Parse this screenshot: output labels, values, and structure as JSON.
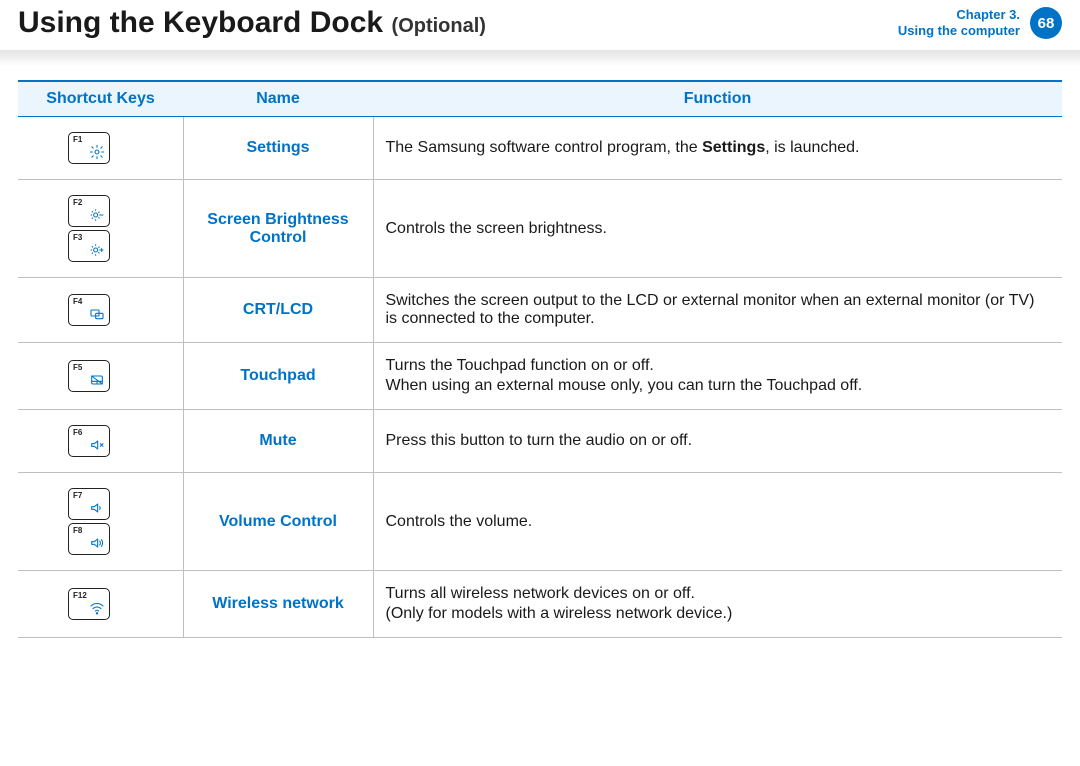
{
  "header": {
    "title_main": "Using the Keyboard Dock",
    "title_sub": "(Optional)",
    "chapter_line1": "Chapter 3.",
    "chapter_line2": "Using the computer",
    "page_number": "68"
  },
  "table": {
    "headers": {
      "keys": "Shortcut Keys",
      "name": "Name",
      "function": "Function"
    },
    "rows": [
      {
        "keys": [
          "F1"
        ],
        "icon": "settings",
        "name": "Settings",
        "function_prefix": "The Samsung software control program, the ",
        "function_bold": "Settings",
        "function_suffix": ", is launched."
      },
      {
        "keys": [
          "F2",
          "F3"
        ],
        "icon": "brightness",
        "name": "Screen Brightness Control",
        "function_line1": "Controls the screen brightness."
      },
      {
        "keys": [
          "F4"
        ],
        "icon": "crtlcd",
        "name": "CRT/LCD",
        "function_line1": "Switches the screen output to the LCD or external monitor when an external monitor (or TV) is connected to the computer."
      },
      {
        "keys": [
          "F5"
        ],
        "icon": "touchpad",
        "name": "Touchpad",
        "function_line1": "Turns the Touchpad function on or off.",
        "function_line2": "When using an external mouse only, you can turn the Touchpad off."
      },
      {
        "keys": [
          "F6"
        ],
        "icon": "mute",
        "name": "Mute",
        "function_line1": "Press this button to turn the audio on or off."
      },
      {
        "keys": [
          "F7",
          "F8"
        ],
        "icon": "volume",
        "name": "Volume Control",
        "function_line1": "Controls the volume."
      },
      {
        "keys": [
          "F12"
        ],
        "icon": "wifi",
        "name": "Wireless network",
        "function_line1": "Turns all wireless network devices on or off.",
        "function_line2": "(Only for models with a wireless network device.)"
      }
    ]
  }
}
